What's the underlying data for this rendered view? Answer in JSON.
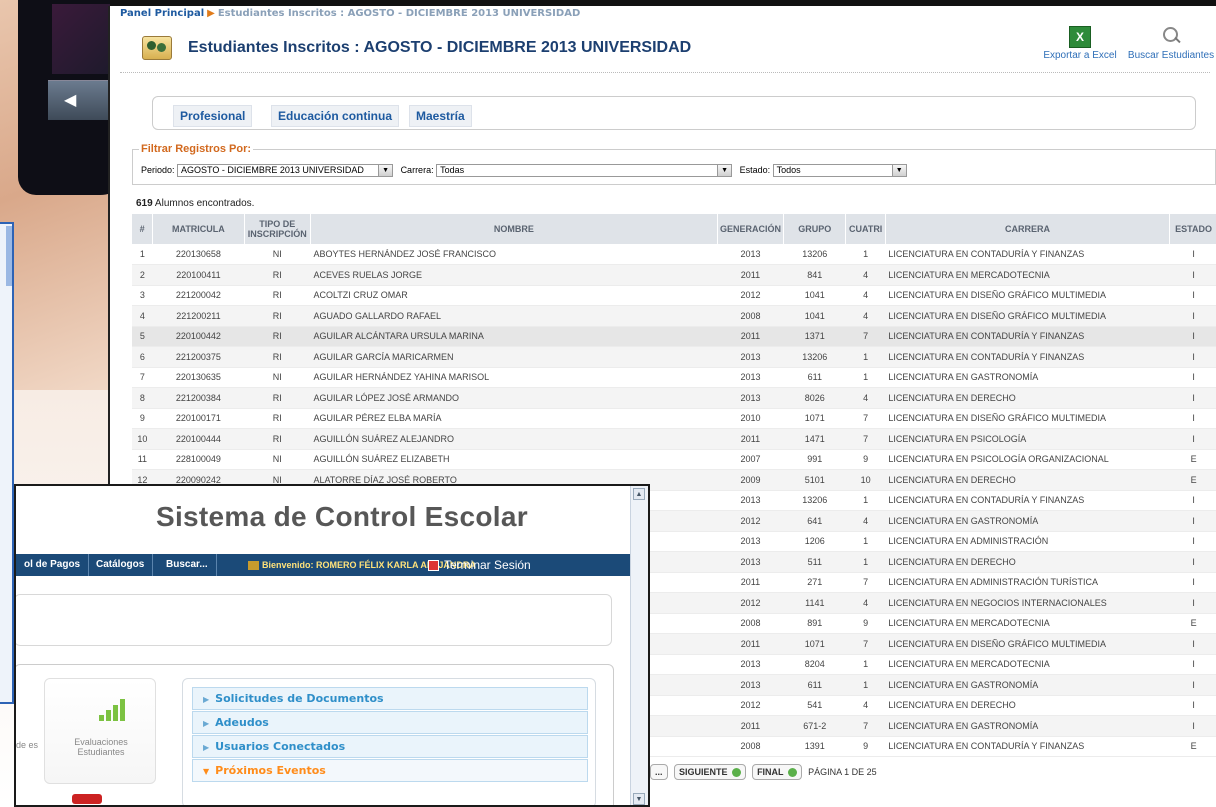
{
  "report": {
    "breadcrumb": {
      "home": "Panel Principal",
      "current": "Estudiantes Inscritos : AGOSTO - DICIEMBRE 2013 UNIVERSIDAD"
    },
    "title": "Estudiantes Inscritos : AGOSTO - DICIEMBRE 2013 UNIVERSIDAD",
    "tools": {
      "export": "Exportar a Excel",
      "search": "Buscar Estudiantes"
    },
    "tabs": [
      "Profesional",
      "Educación continua",
      "Maestría"
    ],
    "filter": {
      "title": "Filtrar Registros Por:",
      "period_label": "Periodo:",
      "period_value": "AGOSTO - DICIEMBRE 2013 UNIVERSIDAD",
      "career_label": "Carrera:",
      "career_value": "Todas",
      "state_label": "Estado:",
      "state_value": "Todos"
    },
    "found_count": "619",
    "found_text": "Alumnos encontrados.",
    "columns": [
      "#",
      "MATRICULA",
      "TIPO DE INSCRIPCIÓN",
      "NOMBRE",
      "GENERACIÓN",
      "GRUPO",
      "CUATRI",
      "CARRERA",
      "ESTADO"
    ],
    "rows": [
      [
        "1",
        "220130658",
        "NI",
        "ABOYTES HERNÁNDEZ JOSÉ FRANCISCO",
        "2013",
        "13206",
        "1",
        "LICENCIATURA EN CONTADURÍA Y FINANZAS",
        "I"
      ],
      [
        "2",
        "220100411",
        "RI",
        "ACEVES RUELAS JORGE",
        "2011",
        "841",
        "4",
        "LICENCIATURA EN MERCADOTECNIA",
        "I"
      ],
      [
        "3",
        "221200042",
        "RI",
        "ACOLTZI CRUZ OMAR",
        "2012",
        "1041",
        "4",
        "LICENCIATURA EN DISEÑO GRÁFICO MULTIMEDIA",
        "I"
      ],
      [
        "4",
        "221200211",
        "RI",
        "AGUADO GALLARDO RAFAEL",
        "2008",
        "1041",
        "4",
        "LICENCIATURA EN DISEÑO GRÁFICO MULTIMEDIA",
        "I"
      ],
      [
        "5",
        "220100442",
        "RI",
        "AGUILAR ALCÁNTARA URSULA MARINA",
        "2011",
        "1371",
        "7",
        "LICENCIATURA EN CONTADURÍA Y FINANZAS",
        "I"
      ],
      [
        "6",
        "221200375",
        "RI",
        "AGUILAR GARCÍA MARICARMEN",
        "2013",
        "13206",
        "1",
        "LICENCIATURA EN CONTADURÍA Y FINANZAS",
        "I"
      ],
      [
        "7",
        "220130635",
        "NI",
        "AGUILAR HERNÁNDEZ YAHINA MARISOL",
        "2013",
        "611",
        "1",
        "LICENCIATURA EN GASTRONOMÍA",
        "I"
      ],
      [
        "8",
        "221200384",
        "RI",
        "AGUILAR LÓPEZ JOSÉ ARMANDO",
        "2013",
        "8026",
        "4",
        "LICENCIATURA EN DERECHO",
        "I"
      ],
      [
        "9",
        "220100171",
        "RI",
        "AGUILAR PÉREZ ELBA MARÍA",
        "2010",
        "1071",
        "7",
        "LICENCIATURA EN DISEÑO GRÁFICO MULTIMEDIA",
        "I"
      ],
      [
        "10",
        "220100444",
        "RI",
        "AGUILLÓN SUÁREZ ALEJANDRO",
        "2011",
        "1471",
        "7",
        "LICENCIATURA EN PSICOLOGÍA",
        "I"
      ],
      [
        "11",
        "228100049",
        "NI",
        "AGUILLÓN SUÁREZ ELIZABETH",
        "2007",
        "991",
        "9",
        "LICENCIATURA EN PSICOLOGÍA ORGANIZACIONAL",
        "E"
      ],
      [
        "12",
        "220090242",
        "NI",
        "ALATORRE DÍAZ JOSÉ ROBERTO",
        "2009",
        "5101",
        "10",
        "LICENCIATURA EN DERECHO",
        "E"
      ],
      [
        "",
        "",
        "",
        "",
        "2013",
        "13206",
        "1",
        "LICENCIATURA EN CONTADURÍA Y FINANZAS",
        "I"
      ],
      [
        "",
        "",
        "",
        "",
        "2012",
        "641",
        "4",
        "LICENCIATURA EN GASTRONOMÍA",
        "I"
      ],
      [
        "",
        "",
        "",
        "",
        "2013",
        "1206",
        "1",
        "LICENCIATURA EN ADMINISTRACIÓN",
        "I"
      ],
      [
        "",
        "",
        "",
        "",
        "2013",
        "511",
        "1",
        "LICENCIATURA EN DERECHO",
        "I"
      ],
      [
        "",
        "",
        "",
        "",
        "2011",
        "271",
        "7",
        "LICENCIATURA EN ADMINISTRACIÓN TURÍSTICA",
        "I"
      ],
      [
        "",
        "",
        "",
        "",
        "2012",
        "1141",
        "4",
        "LICENCIATURA EN NEGOCIOS INTERNACIONALES",
        "I"
      ],
      [
        "",
        "",
        "",
        "",
        "2008",
        "891",
        "9",
        "LICENCIATURA EN MERCADOTECNIA",
        "E"
      ],
      [
        "",
        "",
        "",
        "",
        "2011",
        "1071",
        "7",
        "LICENCIATURA EN DISEÑO GRÁFICO MULTIMEDIA",
        "I"
      ],
      [
        "",
        "",
        "",
        "",
        "2013",
        "8204",
        "1",
        "LICENCIATURA EN MERCADOTECNIA",
        "I"
      ],
      [
        "",
        "",
        "",
        "",
        "2013",
        "611",
        "1",
        "LICENCIATURA EN GASTRONOMÍA",
        "I"
      ],
      [
        "",
        "",
        "",
        "",
        "2012",
        "541",
        "4",
        "LICENCIATURA EN DERECHO",
        "I"
      ],
      [
        "",
        "",
        "",
        "",
        "2011",
        "671-2",
        "7",
        "LICENCIATURA EN GASTRONOMÍA",
        "I"
      ],
      [
        "",
        "",
        "",
        "",
        "2008",
        "1391",
        "9",
        "LICENCIATURA EN CONTADURÍA Y FINANZAS",
        "E"
      ]
    ],
    "pager": {
      "ellipsis": "...",
      "next": "SIGUIENTE",
      "last": "FINAL",
      "page": "PÁGINA 1 DE 25"
    }
  },
  "front": {
    "title": "Sistema de Control Escolar",
    "menu": [
      "ol de Pagos",
      "Catálogos",
      "Buscar..."
    ],
    "welcome": "Bienvenido: ROMERO FÉLIX KARLA ALEJANDRA",
    "logout": "Terminar Sesión",
    "eval_label": "Evaluaciones Estudiantes",
    "left_label": "de es",
    "accordion": [
      "Solicitudes de Documentos",
      "Adeudos",
      "Usuarios Conectados",
      "Próximos Eventos"
    ]
  },
  "colors": {
    "header_navy": "#1b4a78",
    "link_blue": "#1e5aa0",
    "accent_orange": "#ff8c1a"
  }
}
